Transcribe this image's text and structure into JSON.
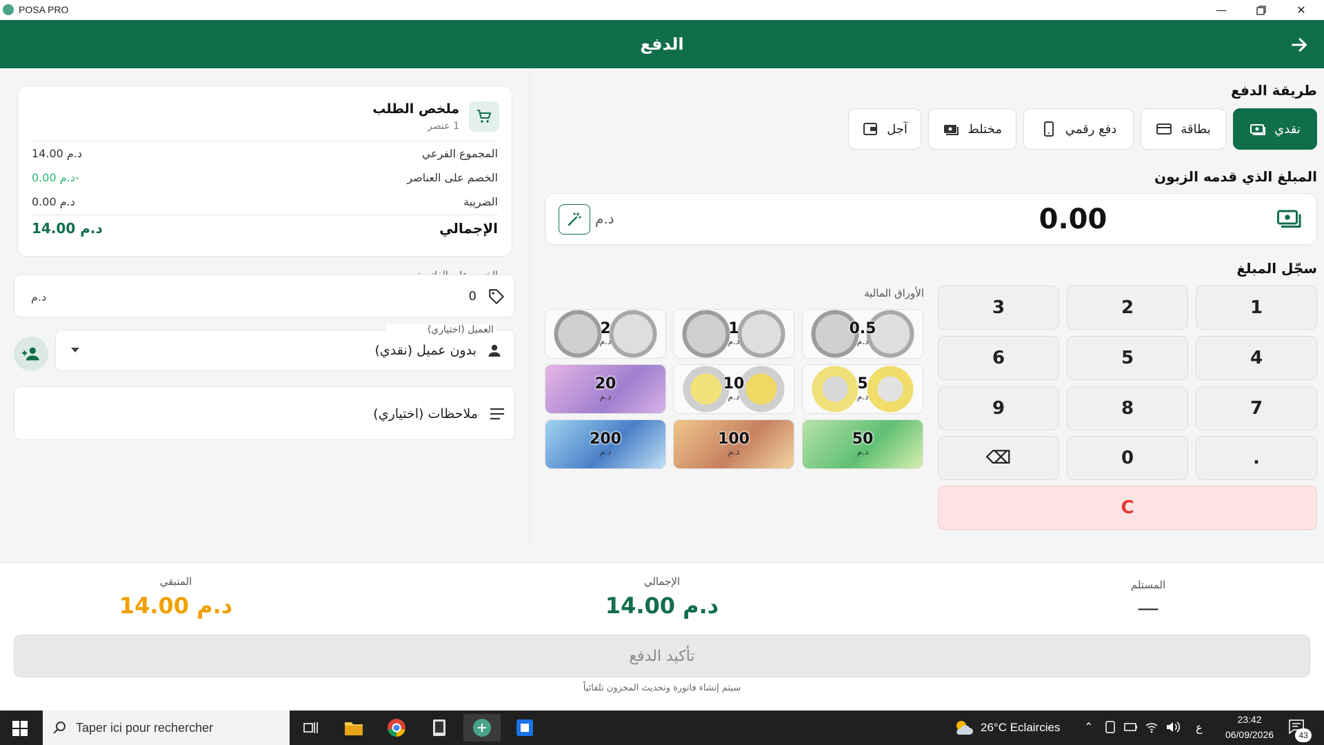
{
  "window": {
    "title": "POSA PRO"
  },
  "header": {
    "title": "الدفع",
    "back_icon": "arrow-right-icon"
  },
  "payment_method": {
    "title": "طريقة الدفع",
    "methods": [
      {
        "label": "نقدي",
        "icon": "cash-icon",
        "active": true
      },
      {
        "label": "بطاقة",
        "icon": "card-icon"
      },
      {
        "label": "دفع رقمي",
        "icon": "phone-icon"
      },
      {
        "label": "مختلط",
        "icon": "mixed-payment-icon"
      },
      {
        "label": "آجل",
        "icon": "wallet-icon"
      }
    ]
  },
  "amount_given": {
    "title": "المبلغ الذي قدمه الزبون",
    "value": "0.00",
    "currency": "د.م"
  },
  "keypad": {
    "title": "سجّل المبلغ",
    "keys": [
      "1",
      "2",
      "3",
      "4",
      "5",
      "6",
      "7",
      "8",
      "9",
      ".",
      "0",
      "⌫"
    ],
    "clear": "C"
  },
  "currency": {
    "title": "الأوراق المالية",
    "unit": "د.م",
    "items": [
      "0.5",
      "1",
      "2",
      "5",
      "10",
      "20",
      "50",
      "100",
      "200"
    ]
  },
  "order_summary": {
    "title": "ملخص الطلب",
    "count": "1 عنصر",
    "rows": [
      {
        "label": "المجموع الفرعي",
        "value": "د.م 14.00"
      },
      {
        "label": "الخصم على العناصر",
        "value": "-د.م 0.00"
      },
      {
        "label": "الضريبة",
        "value": "د.م 0.00"
      }
    ],
    "total_label": "الإجمالي",
    "total_value": "د.م 14.00"
  },
  "invoice_discount": {
    "label": "الخصم على الفاتورة",
    "value": "0",
    "currency": "د.م"
  },
  "customer": {
    "label": "العميل (اختياري)",
    "value": "بدون عميل (نقدي)"
  },
  "notes": {
    "placeholder": "ملاحظات (اختياري)"
  },
  "footer": {
    "received_label": "المستلم",
    "received_value": "—",
    "total_label": "الإجمالي",
    "total_value": "د.م 14.00",
    "remaining_label": "المتبقي",
    "remaining_value": "د.م 14.00",
    "confirm_label": "تأكيد الدفع",
    "hint": "سيتم إنشاء فاتورة وتحديث المخزون تلقائياً"
  },
  "taskbar": {
    "search_placeholder": "Taper ici pour rechercher",
    "weather": "26°C Eclaircies",
    "lang": "ع",
    "time": "23:42",
    "date": "06/09/2026",
    "notifications": "43"
  },
  "colors": {
    "primary": "#116e4b",
    "remaining": "#f0a000",
    "clear_bg": "#fde4e4",
    "clear_text": "#e53935"
  }
}
